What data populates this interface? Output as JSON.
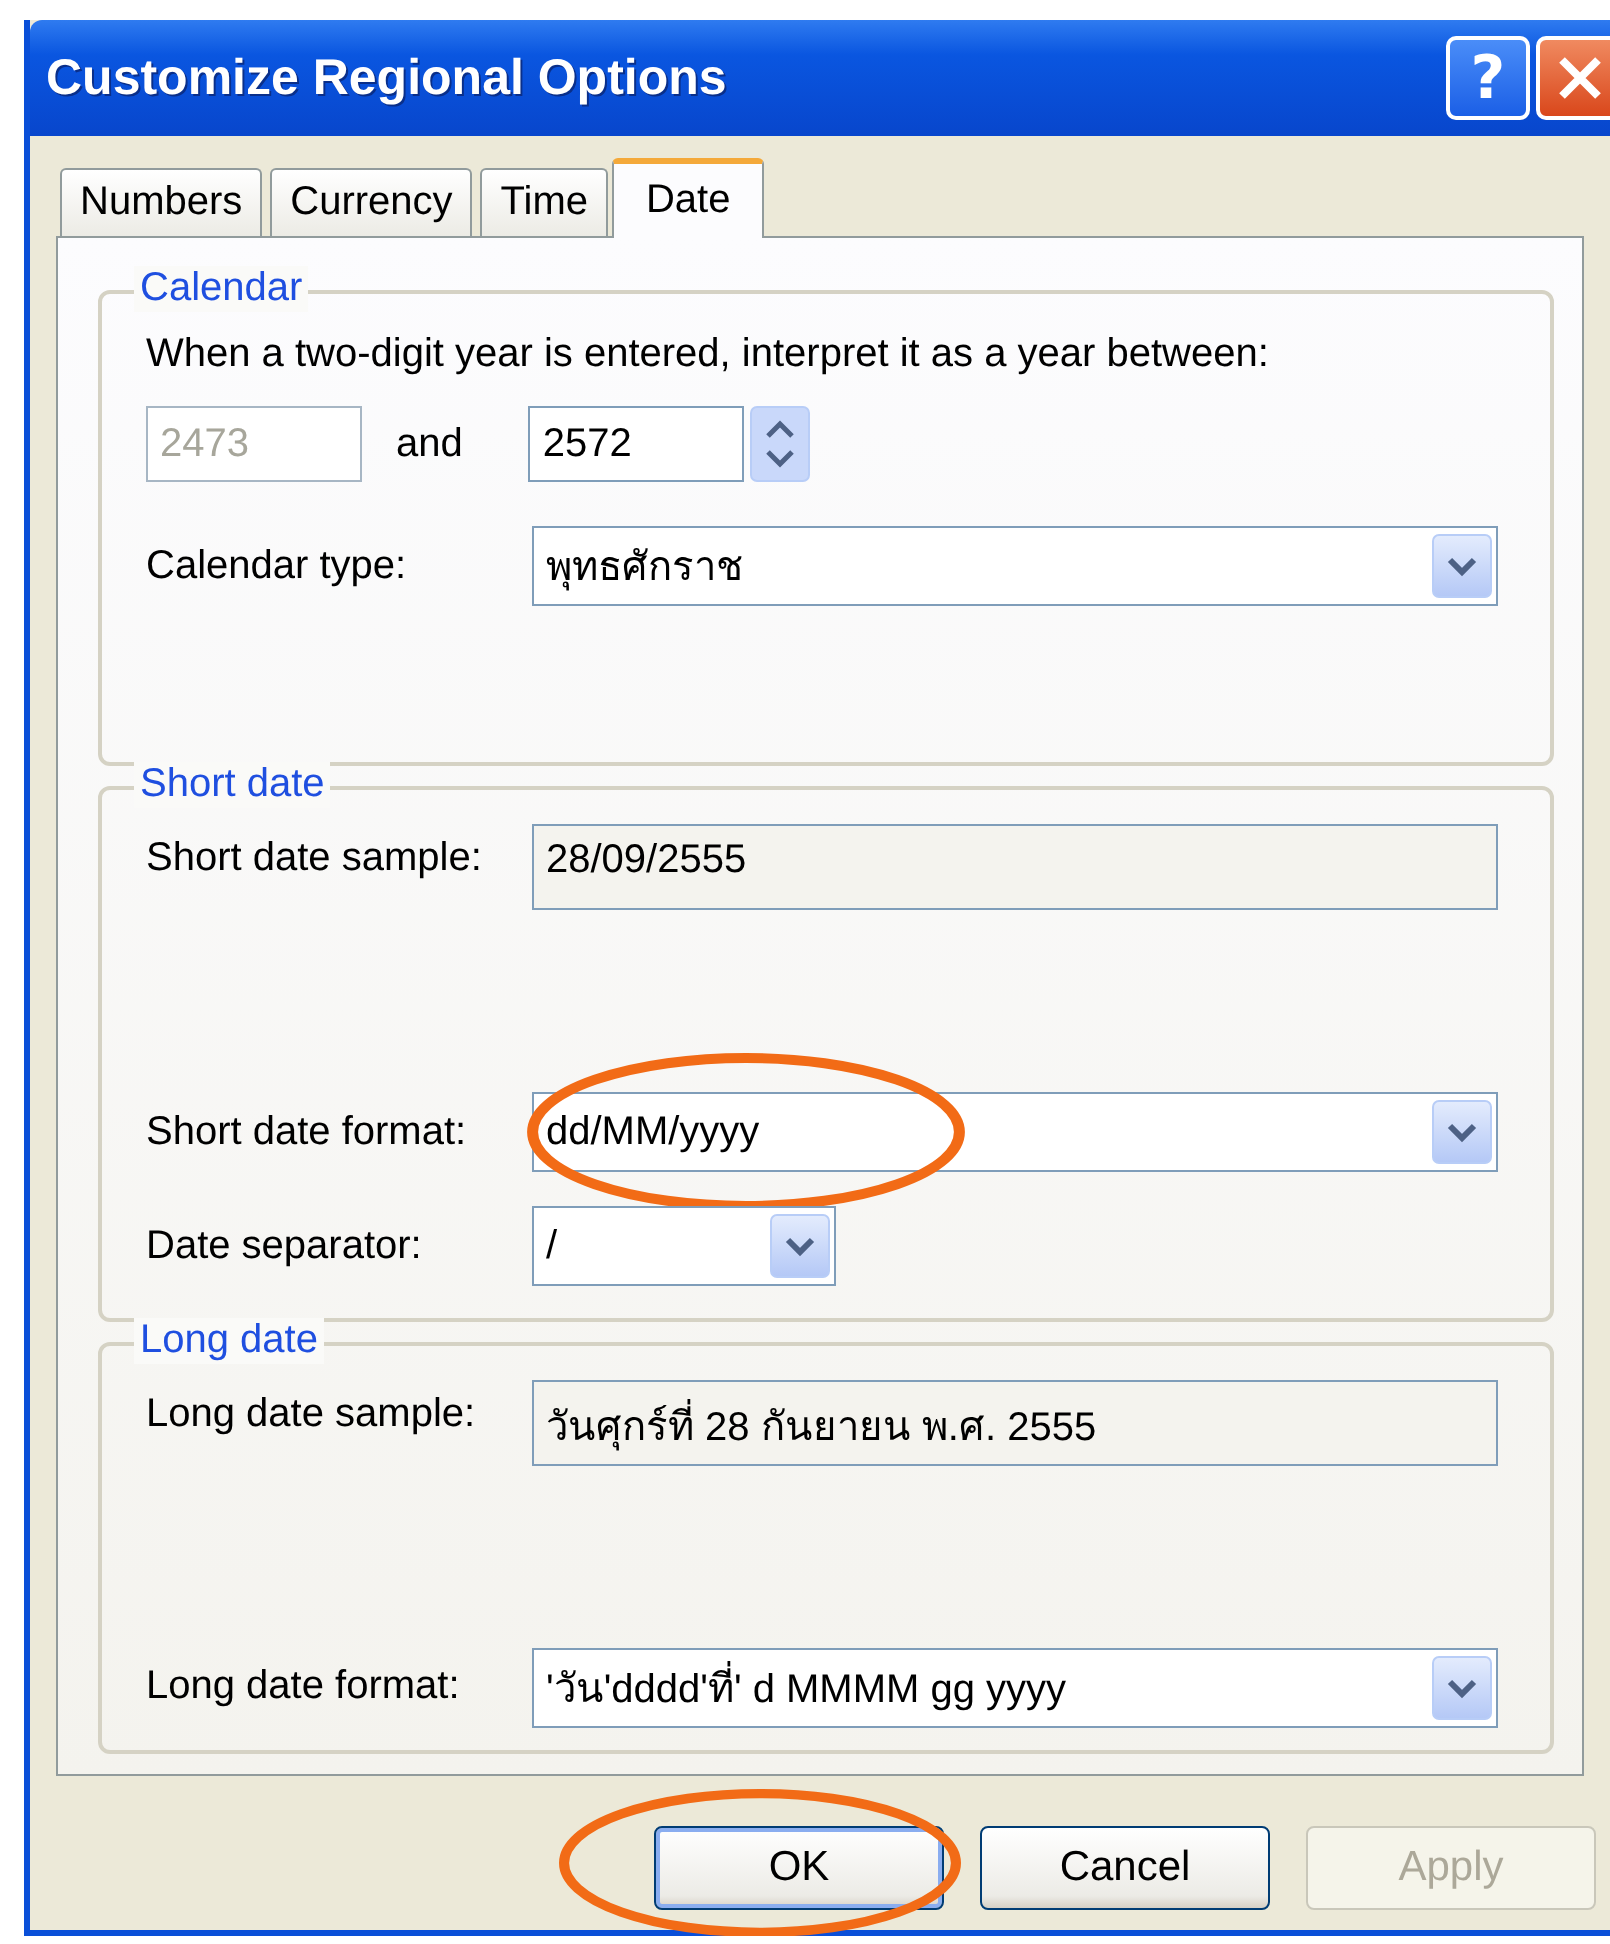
{
  "window": {
    "title": "Customize Regional Options",
    "help_label": "?"
  },
  "tabs": [
    {
      "label": "Numbers",
      "selected": false
    },
    {
      "label": "Currency",
      "selected": false
    },
    {
      "label": "Time",
      "selected": false
    },
    {
      "label": "Date",
      "selected": true
    }
  ],
  "groups": [
    {
      "title": "Calendar",
      "rows": [
        {
          "kind": "text",
          "text": "When a two-digit year is entered, interpret it as a year between:"
        },
        {
          "kind": "year_range",
          "from": {
            "value": "2473",
            "disabled": true
          },
          "joiner": "and",
          "to": {
            "value": "2572",
            "disabled": false
          }
        },
        {
          "kind": "combo",
          "label": "Calendar type:",
          "value": "พุทธศักราช",
          "circled": false
        }
      ]
    },
    {
      "title": "Short date",
      "rows": [
        {
          "kind": "readonly",
          "label": "Short date sample:",
          "value": "28/09/2555"
        },
        {
          "kind": "combo",
          "label": "Short date format:",
          "value": "dd/MM/yyyy",
          "circled": true
        },
        {
          "kind": "short_combo",
          "label": "Date separator:",
          "value": "/",
          "circled": false
        }
      ]
    },
    {
      "title": "Long date",
      "rows": [
        {
          "kind": "readonly",
          "label": "Long date sample:",
          "value": "วันศุกร์ที่ 28 กันยายน พ.ศ. 2555"
        },
        {
          "kind": "combo",
          "label": "Long date format:",
          "value": "'วัน'dddd'ที่' d MMMM gg yyyy",
          "circled": false
        }
      ]
    }
  ],
  "buttons": [
    {
      "label": "OK",
      "default": true,
      "disabled": false,
      "circled": true
    },
    {
      "label": "Cancel",
      "default": false,
      "disabled": false,
      "circled": false
    },
    {
      "label": "Apply",
      "default": false,
      "disabled": true,
      "circled": false
    }
  ]
}
